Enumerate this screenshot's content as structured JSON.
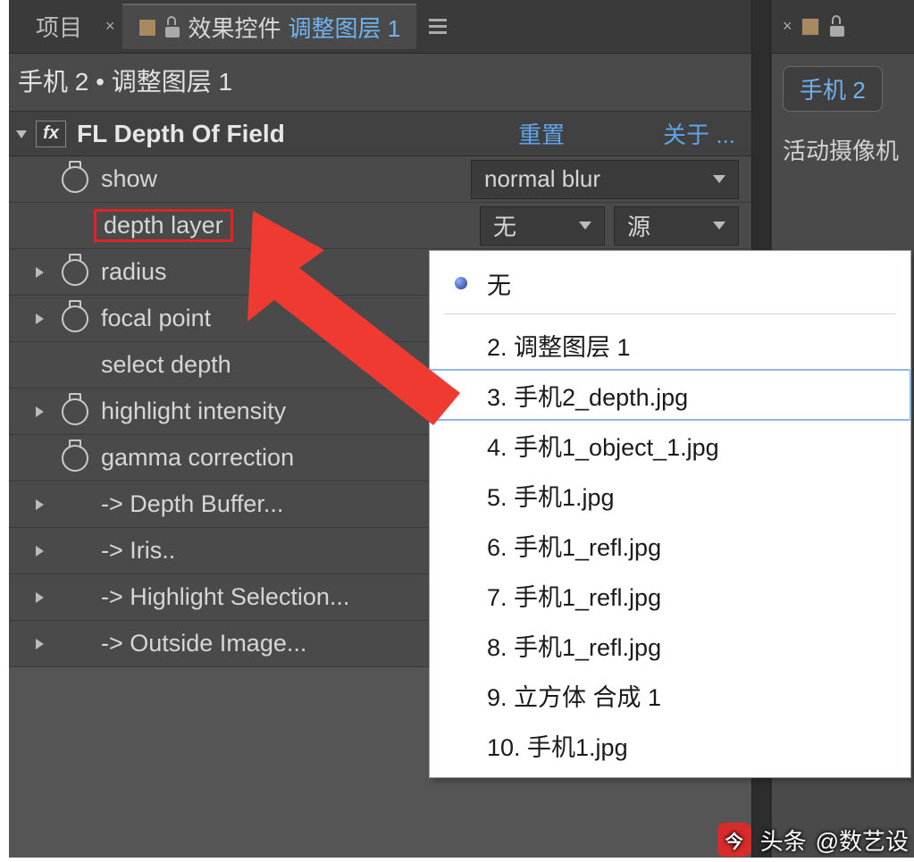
{
  "tabs": {
    "project": "项目",
    "effectsPrefix": "效果控件",
    "effectsTarget": "调整图层 1"
  },
  "breadcrumb": "手机 2 • 调整图层 1",
  "effect": {
    "name": "FL Depth Of Field",
    "reset": "重置",
    "about": "关于 ...",
    "params": [
      {
        "id": "show",
        "label": "show",
        "stopwatch": true,
        "expand": false
      },
      {
        "id": "depthlayer",
        "label": "depth layer",
        "stopwatch": false,
        "expand": false,
        "boxed": true
      },
      {
        "id": "radius",
        "label": "radius",
        "stopwatch": true,
        "expand": true
      },
      {
        "id": "focal",
        "label": "focal point",
        "stopwatch": true,
        "expand": true
      },
      {
        "id": "seldepth",
        "label": "select depth",
        "stopwatch": false,
        "expand": false
      },
      {
        "id": "hilite",
        "label": "highlight intensity",
        "stopwatch": true,
        "expand": true
      },
      {
        "id": "gamma",
        "label": "gamma correction",
        "stopwatch": true,
        "expand": false
      },
      {
        "id": "dbuf",
        "label": "-> Depth Buffer...",
        "stopwatch": false,
        "expand": true
      },
      {
        "id": "iris",
        "label": "-> Iris..",
        "stopwatch": false,
        "expand": true
      },
      {
        "id": "hsel",
        "label": "-> Highlight Selection...",
        "stopwatch": false,
        "expand": true
      },
      {
        "id": "outimg",
        "label": "-> Outside Image...",
        "stopwatch": false,
        "expand": true
      }
    ],
    "showDropdown": "normal blur",
    "depthDropdown1": "无",
    "depthDropdown2": "源"
  },
  "popup": {
    "none": "无",
    "items": [
      "2. 调整图层 1",
      "3. 手机2_depth.jpg",
      "4. 手机1_object_1.jpg",
      "5. 手机1.jpg",
      "6. 手机1_refl.jpg",
      "7. 手机1_refl.jpg",
      "8. 手机1_refl.jpg",
      "9. 立方体 合成 1",
      "10. 手机1.jpg"
    ],
    "selectedIndex": 1
  },
  "rightPanel": {
    "compTab": "手机 2",
    "cameraStatus": "活动摄像机"
  },
  "watermark": {
    "brand": "头条",
    "handle": "@数艺设"
  }
}
